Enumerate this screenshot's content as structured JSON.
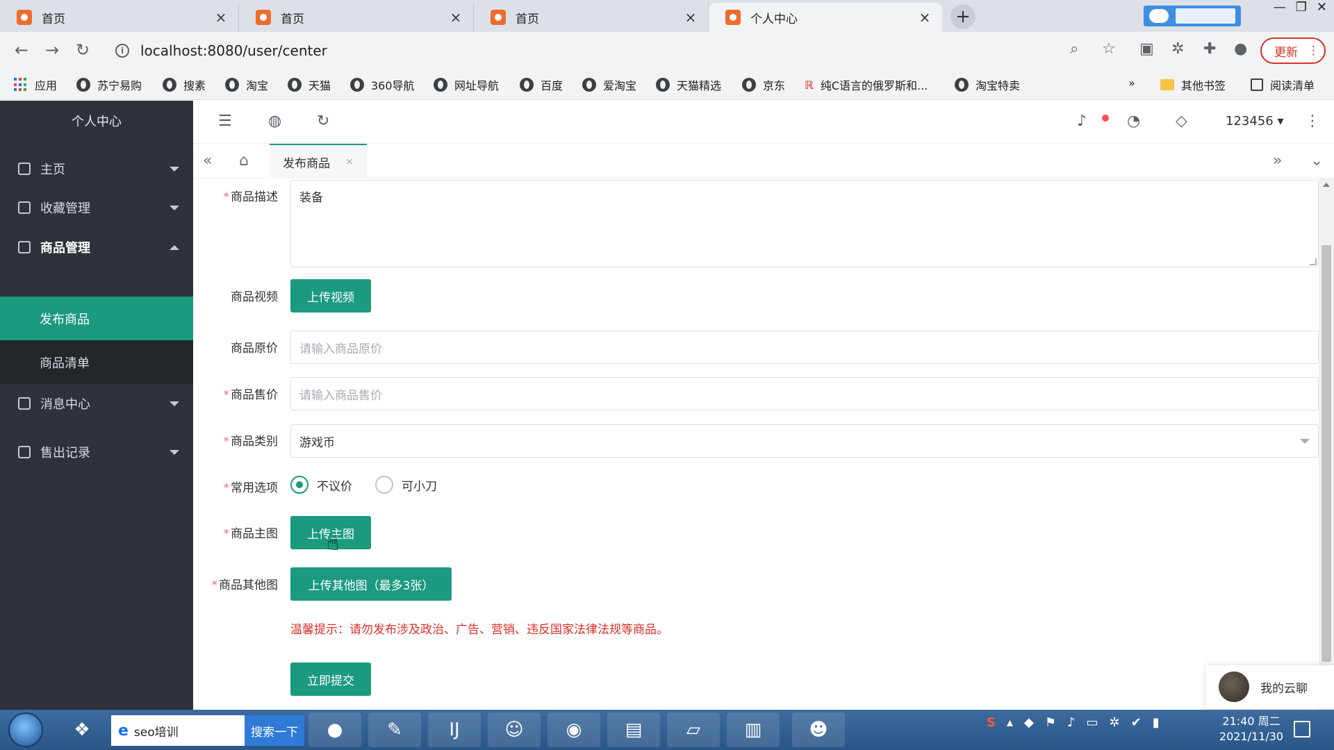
{
  "browser": {
    "tabs": [
      {
        "title": "首页",
        "active": false
      },
      {
        "title": "首页",
        "active": false
      },
      {
        "title": "首页",
        "active": false
      },
      {
        "title": "个人中心",
        "active": true
      }
    ],
    "url": "localhost:8080/user/center",
    "update_label": "更新",
    "bookmarks": [
      {
        "label": "应用",
        "icon": "apps-grid-icon"
      },
      {
        "label": "苏宁易购",
        "icon": "globe-icon"
      },
      {
        "label": "搜素",
        "icon": "globe-icon"
      },
      {
        "label": "淘宝",
        "icon": "globe-icon"
      },
      {
        "label": "天猫",
        "icon": "globe-icon"
      },
      {
        "label": "360导航",
        "icon": "globe-icon"
      },
      {
        "label": "网址导航",
        "icon": "globe-icon"
      },
      {
        "label": "百度",
        "icon": "globe-icon"
      },
      {
        "label": "爱淘宝",
        "icon": "globe-icon"
      },
      {
        "label": "天猫精选",
        "icon": "globe-icon"
      },
      {
        "label": "京东",
        "icon": "globe-icon"
      },
      {
        "label": "纯C语言的俄罗斯和...",
        "icon": "bookmark-favicon"
      },
      {
        "label": "淘宝特卖",
        "icon": "globe-icon"
      }
    ],
    "more_label": "»",
    "other_bookmarks": "其他书签",
    "reading_list": "阅读清单"
  },
  "sidebar": {
    "title": "个人中心",
    "items": [
      {
        "label": "主页",
        "icon": "home-icon",
        "expanded": false
      },
      {
        "label": "收藏管理",
        "icon": "cube-icon",
        "expanded": false
      },
      {
        "label": "商品管理",
        "icon": "goods-icon",
        "expanded": true
      },
      {
        "label": "消息中心",
        "icon": "message-icon",
        "expanded": false
      },
      {
        "label": "售出记录",
        "icon": "record-icon",
        "expanded": false
      }
    ],
    "submenu": [
      {
        "label": "发布商品",
        "active": true
      },
      {
        "label": "商品清单",
        "active": false
      }
    ]
  },
  "header": {
    "user": "123456"
  },
  "page_tab": {
    "label": "发布商品",
    "close": "×"
  },
  "form": {
    "desc_label": "商品描述",
    "desc_value": "装备",
    "video_label": "商品视频",
    "video_button": "上传视频",
    "orig_price_label": "商品原价",
    "orig_price_placeholder": "请输入商品原价",
    "sale_price_label": "商品售价",
    "sale_price_placeholder": "请输入商品售价",
    "category_label": "商品类别",
    "category_value": "游戏币",
    "options_label": "常用选项",
    "option_1": "不议价",
    "option_2": "可小刀",
    "option_selected": "不议价",
    "main_image_label": "商品主图",
    "main_image_button": "上传主图",
    "other_images_label": "商品其他图",
    "other_images_button": "上传其他图（最多3张）",
    "notice": "温馨提示：请勿发布涉及政治、广告、营销、违反国家法律法规等商品。",
    "submit_button": "立即提交",
    "required_mark": "*"
  },
  "chat_widget": {
    "label": "我的云聊"
  },
  "taskbar": {
    "search_value": "seo培训",
    "search_button": "搜索一下",
    "clock_time": "21:40 周二",
    "clock_date": "2021/11/30"
  },
  "colors": {
    "accent": "#1b9a7f",
    "sidebar_bg": "#2f3339",
    "notice": "#d9302c"
  }
}
